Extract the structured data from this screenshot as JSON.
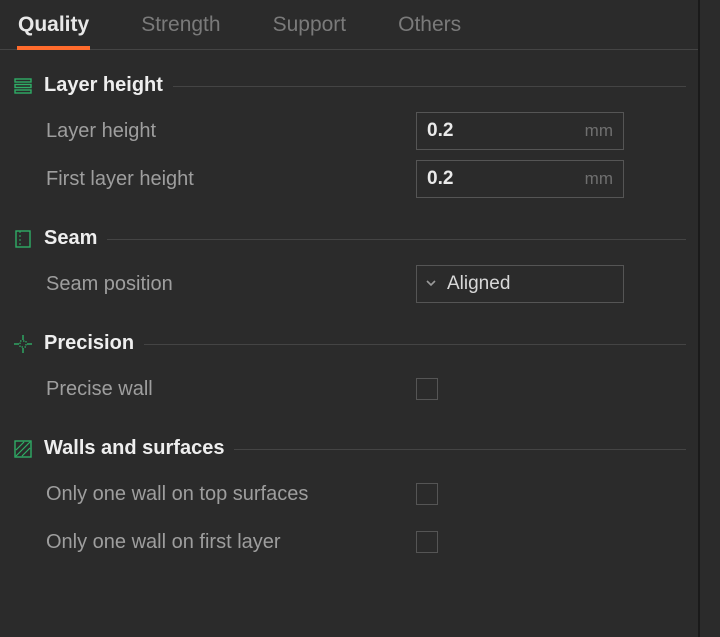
{
  "accent_color": "#ff6b2c",
  "tabs": {
    "quality": "Quality",
    "strength": "Strength",
    "support": "Support",
    "others": "Others",
    "active": "quality"
  },
  "sections": {
    "layer_height": {
      "title": "Layer height",
      "fields": {
        "layer_height": {
          "label": "Layer height",
          "value": "0.2",
          "unit": "mm"
        },
        "first_layer_height": {
          "label": "First layer height",
          "value": "0.2",
          "unit": "mm"
        }
      }
    },
    "seam": {
      "title": "Seam",
      "fields": {
        "seam_position": {
          "label": "Seam position",
          "value": "Aligned"
        }
      }
    },
    "precision": {
      "title": "Precision",
      "fields": {
        "precise_wall": {
          "label": "Precise wall",
          "checked": false
        }
      }
    },
    "walls_surfaces": {
      "title": "Walls and surfaces",
      "fields": {
        "only_one_wall_top": {
          "label": "Only one wall on top surfaces",
          "checked": false
        },
        "only_one_wall_first": {
          "label": "Only one wall on first layer",
          "checked": false
        }
      }
    }
  }
}
